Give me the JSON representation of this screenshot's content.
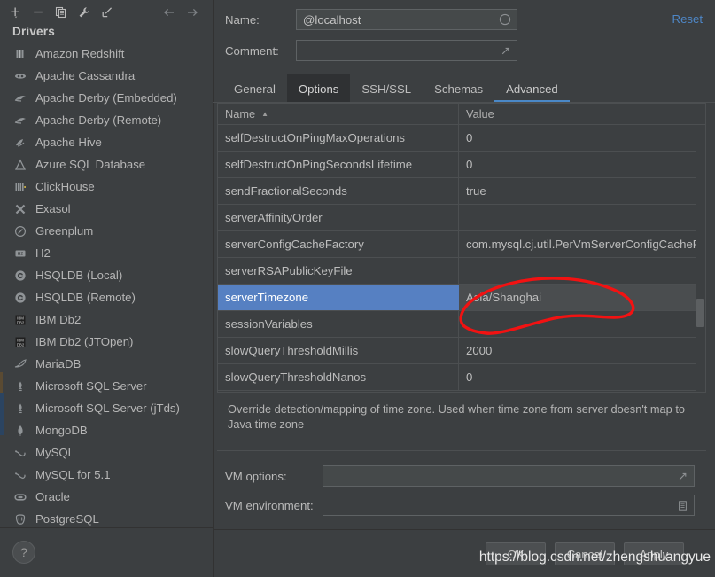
{
  "theme": {
    "bg": "#3c3f41",
    "accent_blue": "#4a88c7",
    "selection_blue": "#5680c2",
    "link_blue": "#4e87c7",
    "annotation_red": "#f21212",
    "text": "#bbbbbb"
  },
  "toolbar": {
    "buttons": [
      {
        "name": "add-driver-button",
        "icon": "plus-dropdown-icon",
        "label": "+"
      },
      {
        "name": "remove-driver-button",
        "icon": "minus-icon",
        "label": "−"
      },
      {
        "name": "duplicate-driver-button",
        "icon": "copy-icon",
        "label": "copy"
      },
      {
        "name": "driver-settings-button",
        "icon": "wrench-icon",
        "label": "wrench"
      },
      {
        "name": "import-button",
        "icon": "arrow-down-left-icon",
        "label": "import"
      }
    ],
    "nav": [
      {
        "name": "back-button",
        "icon": "arrow-left-icon",
        "label": "←"
      },
      {
        "name": "forward-button",
        "icon": "arrow-right-icon",
        "label": "→"
      }
    ]
  },
  "sidebar": {
    "title": "Drivers",
    "help_label": "?",
    "items": [
      {
        "label": "Amazon Redshift",
        "icon": "redshift-icon"
      },
      {
        "label": "Apache Cassandra",
        "icon": "cassandra-icon"
      },
      {
        "label": "Apache Derby (Embedded)",
        "icon": "derby-icon"
      },
      {
        "label": "Apache Derby (Remote)",
        "icon": "derby-icon"
      },
      {
        "label": "Apache Hive",
        "icon": "hive-icon"
      },
      {
        "label": "Azure SQL Database",
        "icon": "azure-icon"
      },
      {
        "label": "ClickHouse",
        "icon": "clickhouse-icon"
      },
      {
        "label": "Exasol",
        "icon": "exasol-icon"
      },
      {
        "label": "Greenplum",
        "icon": "greenplum-icon"
      },
      {
        "label": "H2",
        "icon": "h2-icon"
      },
      {
        "label": "HSQLDB (Local)",
        "icon": "hsqldb-icon"
      },
      {
        "label": "HSQLDB (Remote)",
        "icon": "hsqldb-icon"
      },
      {
        "label": "IBM Db2",
        "icon": "db2-icon"
      },
      {
        "label": "IBM Db2 (JTOpen)",
        "icon": "db2-icon"
      },
      {
        "label": "MariaDB",
        "icon": "mariadb-icon"
      },
      {
        "label": "Microsoft SQL Server",
        "icon": "mssql-icon"
      },
      {
        "label": "Microsoft SQL Server (jTds)",
        "icon": "mssql-icon"
      },
      {
        "label": "MongoDB",
        "icon": "mongodb-icon"
      },
      {
        "label": "MySQL",
        "icon": "mysql-icon"
      },
      {
        "label": "MySQL for 5.1",
        "icon": "mysql-icon"
      },
      {
        "label": "Oracle",
        "icon": "oracle-icon"
      },
      {
        "label": "PostgreSQL",
        "icon": "postgresql-icon"
      }
    ]
  },
  "form": {
    "name_label": "Name:",
    "name_value": "@localhost",
    "name_placeholder": "",
    "comment_label": "Comment:",
    "comment_value": "",
    "comment_placeholder": "",
    "reset_label": "Reset"
  },
  "tabs": [
    {
      "label": "General",
      "state": "normal"
    },
    {
      "label": "Options",
      "state": "hover"
    },
    {
      "label": "SSH/SSL",
      "state": "normal"
    },
    {
      "label": "Schemas",
      "state": "normal"
    },
    {
      "label": "Advanced",
      "state": "active"
    }
  ],
  "table": {
    "columns": [
      "Name",
      "Value"
    ],
    "sort_column": "Name",
    "sort_direction": "asc",
    "rows": [
      {
        "name": "selfDestructOnPingMaxOperations",
        "value": "0",
        "selected": false
      },
      {
        "name": "selfDestructOnPingSecondsLifetime",
        "value": "0",
        "selected": false
      },
      {
        "name": "sendFractionalSeconds",
        "value": "true",
        "selected": false
      },
      {
        "name": "serverAffinityOrder",
        "value": "",
        "selected": false
      },
      {
        "name": "serverConfigCacheFactory",
        "value": "com.mysql.cj.util.PerVmServerConfigCacheFa...",
        "selected": false
      },
      {
        "name": "serverRSAPublicKeyFile",
        "value": "",
        "selected": false
      },
      {
        "name": "serverTimezone",
        "value": "Asia/Shanghai",
        "selected": true
      },
      {
        "name": "sessionVariables",
        "value": "",
        "selected": false
      },
      {
        "name": "slowQueryThresholdMillis",
        "value": "2000",
        "selected": false
      },
      {
        "name": "slowQueryThresholdNanos",
        "value": "0",
        "selected": false
      }
    ]
  },
  "description": "Override detection/mapping of time zone. Used when time zone from server doesn't map to Java time zone",
  "vm": {
    "options_label": "VM options:",
    "options_value": "",
    "environment_label": "VM environment:",
    "environment_value": ""
  },
  "buttons": {
    "ok": "OK",
    "cancel": "Cancel",
    "apply": "Apply"
  },
  "watermark": "https://blog.csdn.net/zhengshuangyue"
}
